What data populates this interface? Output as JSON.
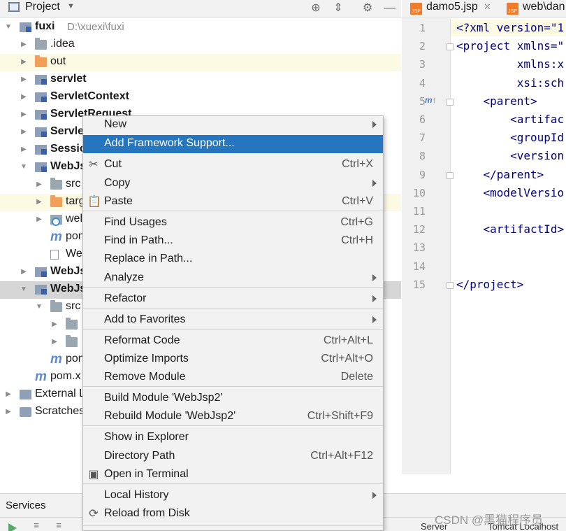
{
  "project_panel": {
    "title": "Project",
    "tree": [
      {
        "label": "fuxi",
        "path": "D:\\xuexi\\fuxi",
        "bold": true,
        "icon": "module-icon"
      },
      {
        "label": ".idea",
        "icon": "folder-icon"
      },
      {
        "label": "out",
        "icon": "folder-orange-icon"
      },
      {
        "label": "servlet",
        "bold": true,
        "icon": "module-icon"
      },
      {
        "label": "ServletContext",
        "bold": true,
        "icon": "module-icon"
      },
      {
        "label": "ServletRequest",
        "bold": true,
        "icon": "module-icon"
      },
      {
        "label": "Servle",
        "bold": true,
        "icon": "module-icon"
      },
      {
        "label": "Sessio",
        "bold": true,
        "icon": "module-icon"
      },
      {
        "label": "WebJs",
        "bold": true,
        "icon": "module-icon"
      },
      {
        "label": "src",
        "icon": "folder-icon"
      },
      {
        "label": "targ",
        "icon": "folder-orange-icon"
      },
      {
        "label": "wel",
        "icon": "web-folder-icon"
      },
      {
        "label": "pon",
        "icon": "maven-icon"
      },
      {
        "label": "We",
        "icon": "file-icon"
      },
      {
        "label": "WebJs",
        "bold": true,
        "icon": "module-icon"
      },
      {
        "label": "WebJs",
        "bold": true,
        "icon": "module-icon"
      },
      {
        "label": "src",
        "icon": "folder-icon"
      },
      {
        "label": "",
        "icon": "folder-icon"
      },
      {
        "label": "",
        "icon": "folder-icon"
      },
      {
        "label": "pon",
        "icon": "maven-icon"
      },
      {
        "label": "pom.x",
        "icon": "maven-icon"
      },
      {
        "label": "External L",
        "icon": "external-libraries-icon"
      },
      {
        "label": "Scratches",
        "icon": "scratches-icon"
      }
    ]
  },
  "editor": {
    "tabs": [
      {
        "label": "damo5.jsp",
        "icon": "jsp-icon"
      },
      {
        "label": "web\\dan",
        "icon": "jsp-icon"
      }
    ],
    "line_numbers": [
      "1",
      "2",
      "3",
      "4",
      "5",
      "6",
      "7",
      "8",
      "9",
      "10",
      "11",
      "12",
      "13",
      "14",
      "15"
    ],
    "lines": [
      "<?xml version=\"1",
      "<project xmlns=\"",
      "         xmlns:x",
      "         xsi:sch",
      "    <parent>",
      "        <artifac",
      "        <groupId",
      "        <version",
      "    </parent>",
      "    <modelVersio",
      "",
      "    <artifactId>",
      "",
      "",
      "</project>"
    ],
    "gutter_marker": "m"
  },
  "context_menu": {
    "items": [
      {
        "label": "New",
        "shortcut": "",
        "submenu": true
      },
      {
        "label": "Add Framework Support...",
        "shortcut": "",
        "active": true
      },
      {
        "label": "Cut",
        "shortcut": "Ctrl+X",
        "icon": "scissors-icon"
      },
      {
        "label": "Copy",
        "shortcut": "",
        "submenu": true
      },
      {
        "label": "Paste",
        "shortcut": "Ctrl+V",
        "icon": "clipboard-icon"
      },
      {
        "label": "Find Usages",
        "shortcut": "Ctrl+G"
      },
      {
        "label": "Find in Path...",
        "shortcut": "Ctrl+H"
      },
      {
        "label": "Replace in Path...",
        "shortcut": ""
      },
      {
        "label": "Analyze",
        "shortcut": "",
        "submenu": true
      },
      {
        "label": "Refactor",
        "shortcut": "",
        "submenu": true
      },
      {
        "label": "Add to Favorites",
        "shortcut": "",
        "submenu": true
      },
      {
        "label": "Reformat Code",
        "shortcut": "Ctrl+Alt+L"
      },
      {
        "label": "Optimize Imports",
        "shortcut": "Ctrl+Alt+O"
      },
      {
        "label": "Remove Module",
        "shortcut": "Delete"
      },
      {
        "label": "Build Module 'WebJsp2'",
        "shortcut": ""
      },
      {
        "label": "Rebuild Module 'WebJsp2'",
        "shortcut": "Ctrl+Shift+F9"
      },
      {
        "label": "Show in Explorer",
        "shortcut": ""
      },
      {
        "label": "Directory Path",
        "shortcut": "Ctrl+Alt+F12"
      },
      {
        "label": "Open in Terminal",
        "shortcut": "",
        "icon": "terminal-icon"
      },
      {
        "label": "Local History",
        "shortcut": "",
        "submenu": true
      },
      {
        "label": "Reload from Disk",
        "shortcut": "",
        "icon": "reload-icon"
      }
    ]
  },
  "services": {
    "label": "Services",
    "bottom_tabs": [
      "Server",
      "Tomcat Localhost"
    ]
  },
  "watermark": "CSDN @黑猫程序员",
  "colors": {
    "menu_highlight": "#2675bf",
    "highlight_row": "#fcfae2",
    "selected_row": "#d5d5d5"
  }
}
